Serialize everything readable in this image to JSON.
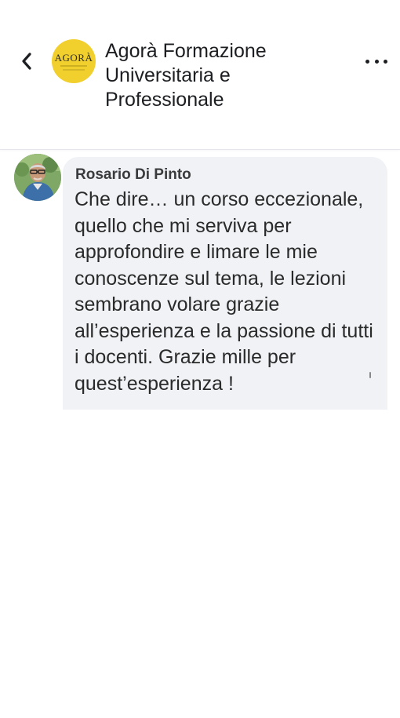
{
  "header": {
    "title": "Agorà Formazione Universitaria e Professionale",
    "logo_text": "AGORÀ",
    "back_icon": "chevron-left-icon",
    "more_icon": "more-horizontal-icon"
  },
  "comment": {
    "author": "Rosario Di Pinto",
    "text": "Che dire… un corso eccezionale, quello che mi serviva per approfondire e limare le mie conoscenze sul tema, le lezioni sembrano volare grazie all’esperienza e la passione di tutti i docenti. Grazie mille per quest’esperienza !"
  },
  "colors": {
    "logo_bg": "#f1cf2c",
    "bubble_bg": "#f0f2f5",
    "text": "#1c1e21"
  }
}
